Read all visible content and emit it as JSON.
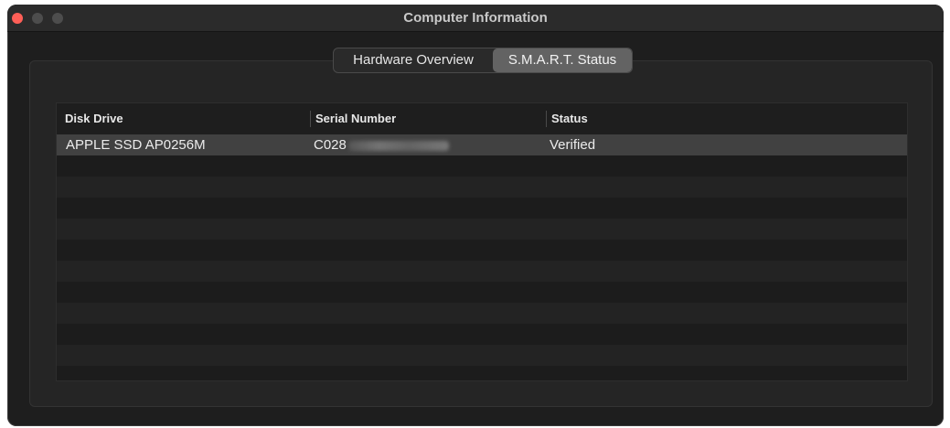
{
  "window": {
    "title": "Computer Information"
  },
  "tabs": [
    {
      "label": "Hardware Overview",
      "selected": false
    },
    {
      "label": "S.M.A.R.T. Status",
      "selected": true
    }
  ],
  "table": {
    "columns": [
      "Disk Drive",
      "Serial Number",
      "Status"
    ],
    "rows": [
      {
        "disk_drive": "APPLE SSD AP0256M",
        "serial_number": "C028",
        "status": "Verified"
      }
    ]
  },
  "colors": {
    "close_button": "#ff5f57",
    "window_bg": "#1e1e1e",
    "selected_tab": "#636363",
    "selected_row": "#414141"
  }
}
